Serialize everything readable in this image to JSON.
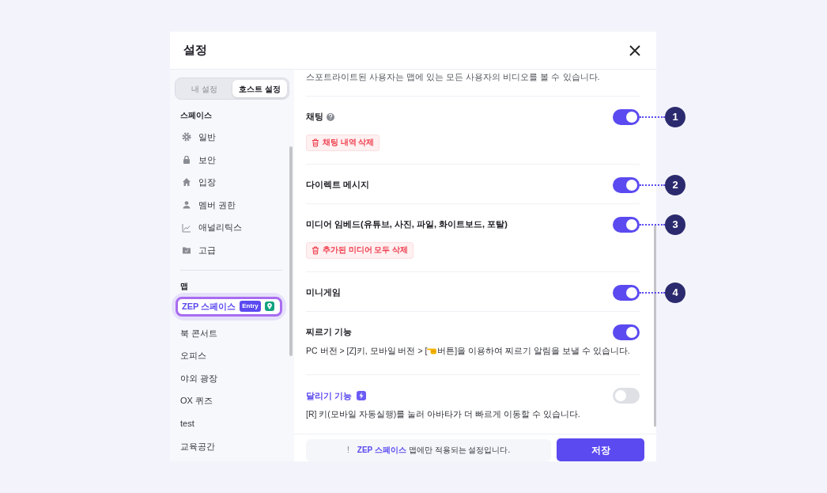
{
  "dialog": {
    "title": "설정"
  },
  "mode_tabs": [
    {
      "label": "내 설정",
      "selected": false
    },
    {
      "label": "호스트 설정",
      "selected": true
    }
  ],
  "sidebar": {
    "space_heading": "스페이스",
    "space_items": [
      {
        "label": "일반"
      },
      {
        "label": "보안"
      },
      {
        "label": "입장"
      },
      {
        "label": "멤버 권한"
      },
      {
        "label": "애널리틱스"
      },
      {
        "label": "고급"
      }
    ],
    "map_heading": "맵",
    "map_items": [
      {
        "label": "ZEP 스페이스",
        "selected": true,
        "badge": "Entry",
        "pin": true
      },
      {
        "label": "북 콘서트",
        "selected": false
      },
      {
        "label": "오피스",
        "selected": false
      },
      {
        "label": "야외 광장",
        "selected": false
      },
      {
        "label": "OX 퀴즈",
        "selected": false
      },
      {
        "label": "test",
        "selected": false
      },
      {
        "label": "교육공간",
        "selected": false
      }
    ]
  },
  "intro_text": "스포트라이트된 사용자는 맵에 있는 모든 사용자의 비디오를 볼 수 있습니다.",
  "settings": [
    {
      "title": "채팅",
      "help": true,
      "on": true,
      "callout": "1",
      "action": "채팅 내역 삭제"
    },
    {
      "title": "다이렉트 메시지",
      "on": true,
      "callout": "2"
    },
    {
      "title": "미디어 임베드(유튜브, 사진, 파일, 화이트보드, 포탈)",
      "on": true,
      "callout": "3",
      "action": "추가된 미디어 모두 삭제"
    },
    {
      "title": "미니게임",
      "on": true,
      "callout": "4"
    },
    {
      "title": "찌르기 기능",
      "on": true,
      "desc_before": "PC 버전 > [Z]키, 모바일 버전 > [",
      "desc_after": "버튼]을 이용하여 찌르기 알림을 보낼 수 있습니다."
    },
    {
      "title": "달리기 기능",
      "premium": true,
      "on": false,
      "desc_before": "[R] 키(모바일 자동실행)를 눌러 아바타가 더 빠르게 이동할 수 있습니다."
    }
  ],
  "footer": {
    "notice_mark": "!",
    "notice_highlight": "ZEP 스페이스",
    "notice_text": "맵에만 적용되는 설정입니다.",
    "save": "저장"
  }
}
